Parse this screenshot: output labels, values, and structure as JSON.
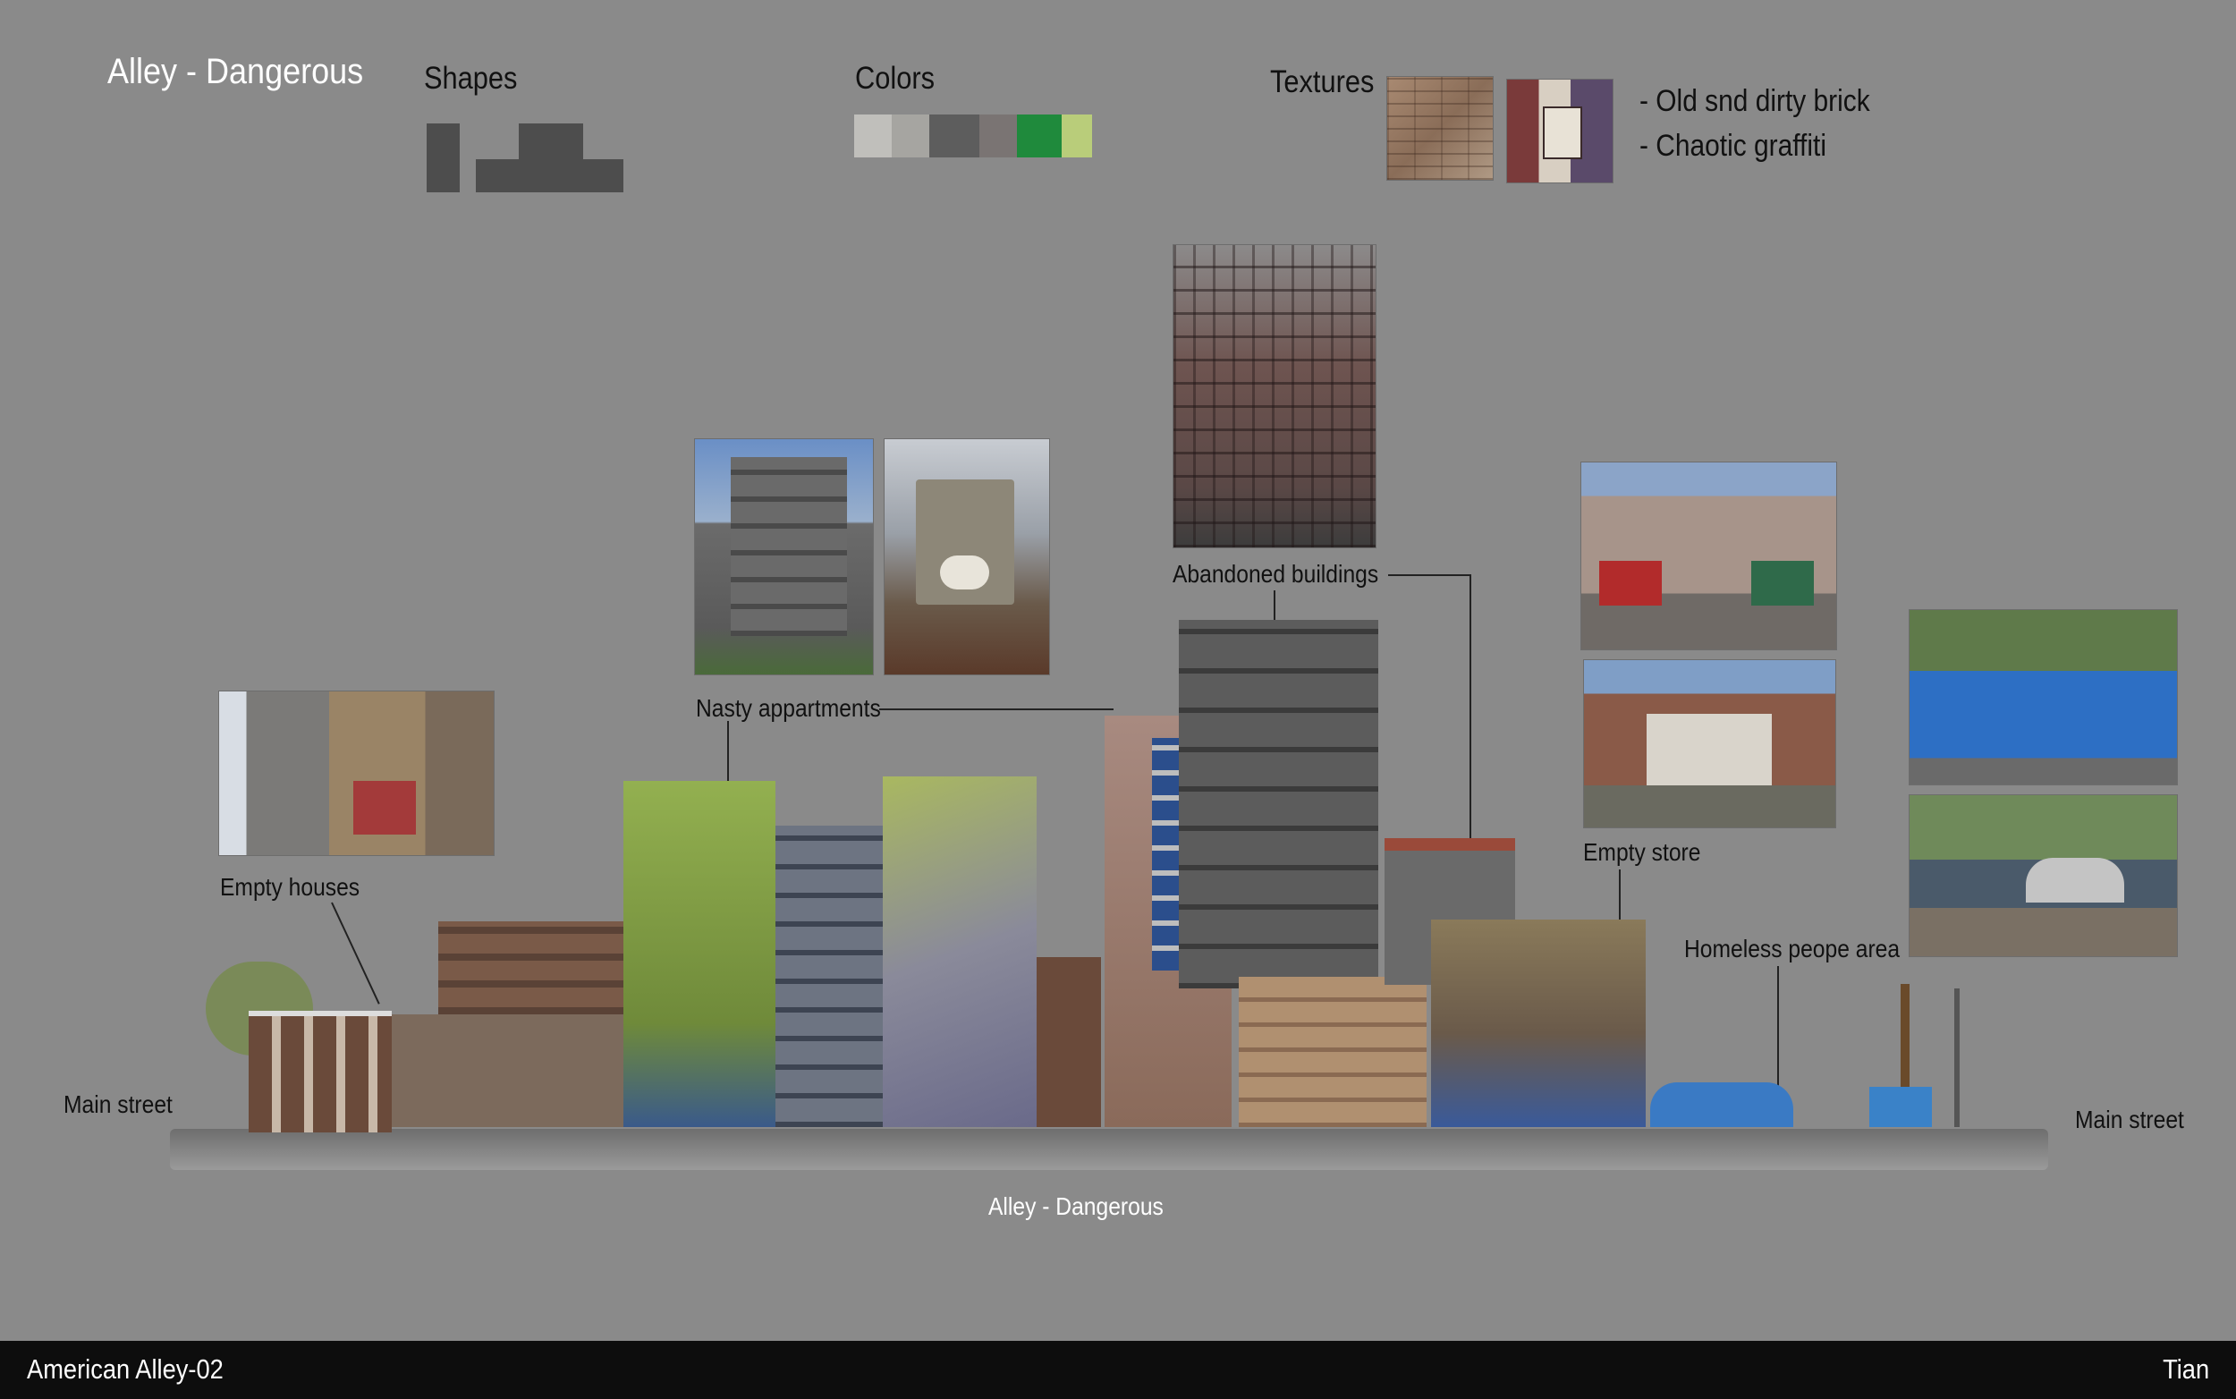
{
  "title": "Alley - Dangerous",
  "sections": {
    "shapes": "Shapes",
    "colors": "Colors",
    "textures": "Textures"
  },
  "palette": [
    "#c0bfbb",
    "#a6a5a1",
    "#5d5d5d",
    "#7a7473",
    "#1f8a3c",
    "#b9cd7a"
  ],
  "texture_notes": [
    "- Old snd dirty brick",
    "- Chaotic graffiti"
  ],
  "labels": {
    "abandoned": "Abandoned buildings",
    "nasty": "Nasty appartments",
    "empty_houses": "Empty houses",
    "empty_store": "Empty store",
    "homeless": "Homeless peope area",
    "main_left": "Main street",
    "main_right": "Main street",
    "alley": "Alley - Dangerous"
  },
  "footer": {
    "left": "American Alley-02",
    "right": "Tian"
  }
}
